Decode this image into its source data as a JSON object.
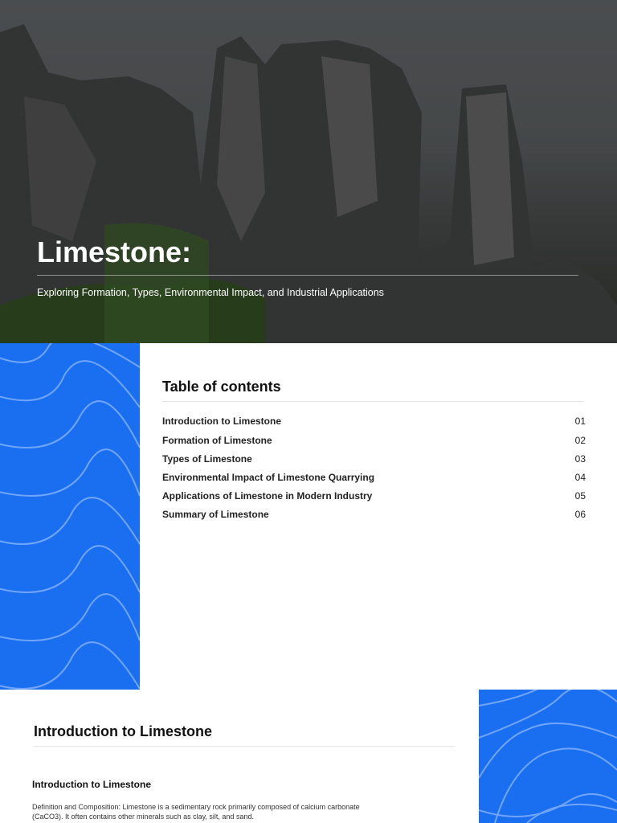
{
  "hero": {
    "title": "Limestone:",
    "subtitle": "Exploring Formation, Types, Environmental Impact, and Industrial Applications"
  },
  "toc": {
    "title": "Table of contents",
    "items": [
      {
        "label": "Introduction to Limestone",
        "num": "01"
      },
      {
        "label": "Formation of Limestone",
        "num": "02"
      },
      {
        "label": "Types of Limestone",
        "num": "03"
      },
      {
        "label": "Environmental Impact of Limestone Quarrying",
        "num": "04"
      },
      {
        "label": "Applications of Limestone in Modern Industry",
        "num": "05"
      },
      {
        "label": "Summary of Limestone",
        "num": "06"
      }
    ]
  },
  "section": {
    "title": "Introduction to Limestone",
    "subtitle": "Introduction to Limestone",
    "paragraph": "Definition and Composition: Limestone is a sedimentary rock primarily composed of calcium carbonate (CaCO3). It often contains other minerals such as clay, silt, and sand."
  },
  "colors": {
    "accent": "#1a6ff0"
  }
}
